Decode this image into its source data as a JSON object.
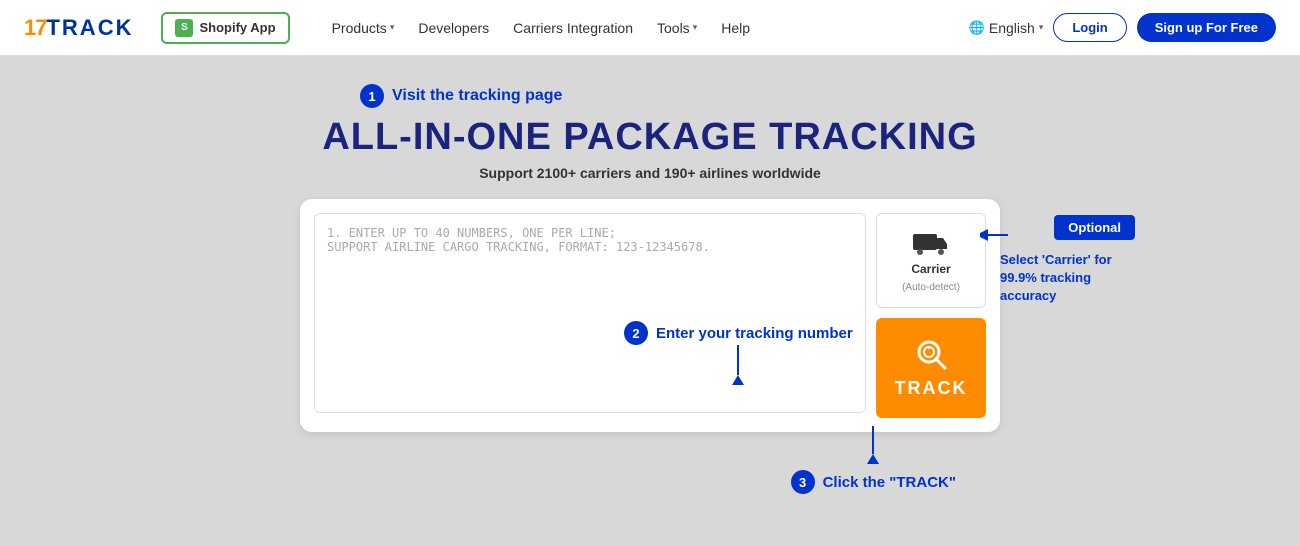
{
  "header": {
    "logo_17": "17",
    "logo_track": "TRACK",
    "shopify_btn": "Shopify App",
    "nav": [
      {
        "label": "Products",
        "hasChevron": true
      },
      {
        "label": "Developers",
        "hasChevron": false
      },
      {
        "label": "Carriers Integration",
        "hasChevron": false
      },
      {
        "label": "Tools",
        "hasChevron": true
      },
      {
        "label": "Help",
        "hasChevron": false
      }
    ],
    "language": "English",
    "login": "Login",
    "signup": "Sign up For Free"
  },
  "main": {
    "step1_label": "Visit the tracking page",
    "page_title": "ALL-IN-ONE PACKAGE TRACKING",
    "page_subtitle": "Support 2100+ carriers and 190+ airlines worldwide",
    "textarea_placeholder_line1": "1. ENTER UP TO 40 NUMBERS, ONE PER LINE;",
    "textarea_placeholder_line2": "SUPPORT AIRLINE CARGO TRACKING, FORMAT: 123-12345678.",
    "carrier_label": "Carrier",
    "carrier_sublabel": "(Auto-detect)",
    "track_btn": "TRACK",
    "step2_label": "Enter your tracking number",
    "step3_label": "Click the \"TRACK\"",
    "optional_badge": "Optional",
    "optional_desc": "Select 'Carrier' for 99.9% tracking accuracy"
  }
}
